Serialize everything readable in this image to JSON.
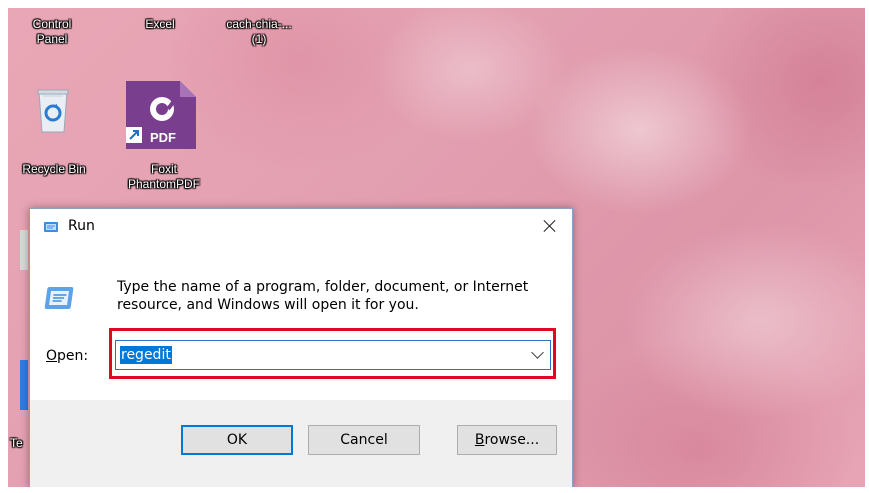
{
  "desktop": {
    "icons": [
      {
        "label": "Control\nPanel"
      },
      {
        "label": "Excel"
      },
      {
        "label": "cach-chia-...\n(1)"
      },
      {
        "label": "Recycle Bin"
      },
      {
        "label": "Foxit\nPhantomPDF"
      },
      {
        "label": "Te"
      }
    ],
    "foxit_badge": "PDF"
  },
  "run_dialog": {
    "title": "Run",
    "description": "Type the name of a program, folder, document, or Internet resource, and Windows will open it for you.",
    "open_label_mnemonic": "O",
    "open_label_rest": "pen:",
    "command_value": "regedit",
    "buttons": {
      "ok": "OK",
      "cancel": "Cancel",
      "browse_mnemonic": "B",
      "browse_rest": "rowse..."
    },
    "highlight_color": "#e0091f",
    "selection_color": "#0078d7"
  }
}
